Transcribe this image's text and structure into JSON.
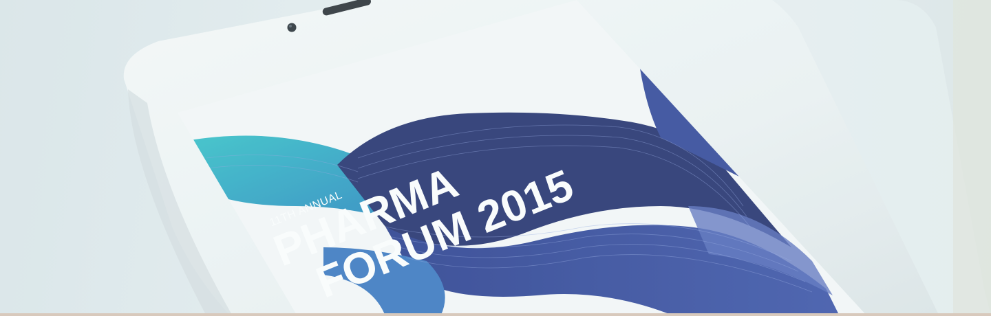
{
  "poster": {
    "edition": "11TH ANNUAL",
    "title_line1": "PHARMA",
    "title_line2": "FORUM 2015"
  },
  "colors": {
    "background": "#e4ecef",
    "phone_body": "#f3f6f7",
    "screen": "#f7f9fa",
    "wave_dark": "#1f2f6e",
    "wave_mid": "#3a4fa0",
    "wave_teal": "#2fb4c6",
    "text": "#ffffff"
  },
  "icons": [
    "earpiece-icon",
    "front-camera-icon"
  ]
}
